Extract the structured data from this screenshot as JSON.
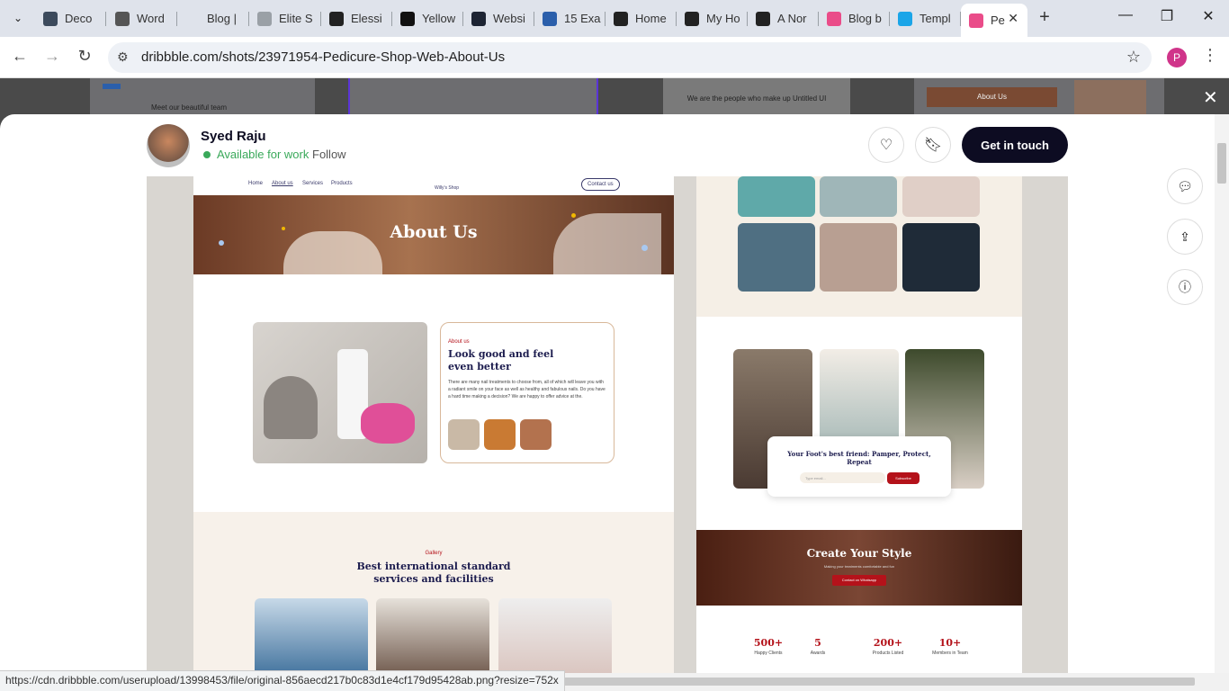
{
  "browser": {
    "tabs": [
      {
        "label": "Deco",
        "color": "#3c4a5c"
      },
      {
        "label": "Word",
        "color": "#555"
      },
      {
        "label": "Blog |",
        "color": "#dfe3eb"
      },
      {
        "label": "Elite S",
        "color": "#9aa0a6"
      },
      {
        "label": "Elessi",
        "color": "#222"
      },
      {
        "label": "Yellow",
        "color": "#111"
      },
      {
        "label": "Websi",
        "color": "#1d2433"
      },
      {
        "label": "15 Exa",
        "color": "#2b5fab"
      },
      {
        "label": "Home",
        "color": "#222"
      },
      {
        "label": "My Ho",
        "color": "#222"
      },
      {
        "label": "A Nor",
        "color": "#222"
      },
      {
        "label": "Blog b",
        "color": "#ea4c89"
      },
      {
        "label": "Templ",
        "color": "#1ba5e8"
      },
      {
        "label": "Pe",
        "color": "#ea4c89"
      }
    ],
    "url": "dribbble.com/shots/23971954-Pedicure-Shop-Web-About-Us",
    "profile_initial": "P",
    "status_url": "https://cdn.dribbble.com/userupload/13998453/file/original-856aecd217b0c83d1e4cf179d95428ab.png?resize=752x"
  },
  "background_shots": [
    {
      "text": "Meet our beautiful team"
    },
    {
      "text": ""
    },
    {
      "text": "We are the people who make up Untitled UI"
    },
    {
      "text": "About Us"
    }
  ],
  "designer": {
    "name": "Syed Raju",
    "availability": "Available for work",
    "follow": "Follow",
    "cta": "Get in touch"
  },
  "shot": {
    "nav": {
      "links": [
        "Home",
        "About us",
        "Services",
        "Products"
      ],
      "logo": "Willy's Shop",
      "contact": "Contact us"
    },
    "hero_title": "About Us",
    "about": {
      "eyebrow": "About us",
      "heading": "Look good and feel even better",
      "body": "There are many nail treatments to choose from, all of which will leave you with a radiant smile on your face as well as healthy and fabulous nails. Do you have a hard time making a decision? We are happy to offer advice at the."
    },
    "gallery": {
      "eyebrow": "Gallery",
      "heading": "Best international standard services and facilities"
    },
    "newsletter": {
      "heading": "Your Foot's best friend: Pamper, Protect, Repeat",
      "placeholder": "Type email...",
      "button": "Subscribe"
    },
    "cta": {
      "heading": "Create Your Style",
      "sub": "Making your treatments comfortable and fun",
      "button": "Contact on Whatsapp"
    },
    "stats": [
      {
        "value": "500+",
        "label": "Happy Clients"
      },
      {
        "value": "5",
        "label": "Awards"
      },
      {
        "value": "200+",
        "label": "Products Listed"
      },
      {
        "value": "10+",
        "label": "Members in Team"
      }
    ],
    "accent": "#b4121a",
    "navy": "#1c1c4e"
  }
}
